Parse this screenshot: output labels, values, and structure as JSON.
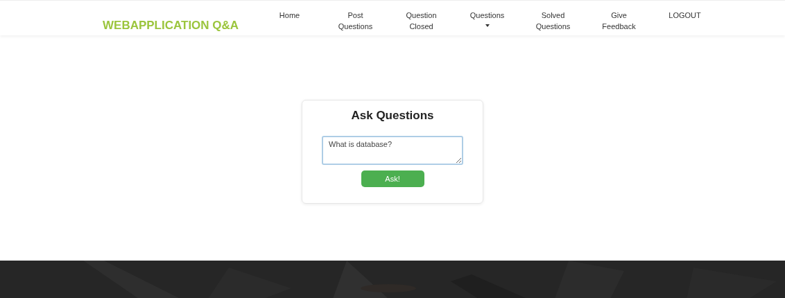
{
  "brand": "WEBAPPLICATION Q&A",
  "nav": [
    {
      "label": "Home",
      "kind": "link"
    },
    {
      "label": "Post\nQuestions",
      "kind": "link"
    },
    {
      "label": "Question\nClosed",
      "kind": "link"
    },
    {
      "label": "Questions",
      "kind": "dropdown"
    },
    {
      "label": "Solved\nQuestions",
      "kind": "link"
    },
    {
      "label": "Give\nFeedback",
      "kind": "link"
    },
    {
      "label": "LOGOUT",
      "kind": "link"
    }
  ],
  "card": {
    "title": "Ask Questions",
    "question": "What is database?",
    "button": "Ask!"
  }
}
